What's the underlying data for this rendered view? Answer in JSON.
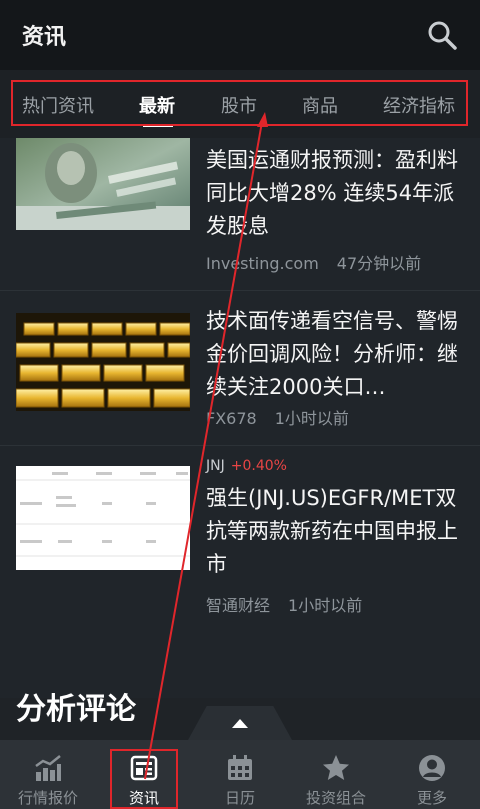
{
  "header": {
    "title": "资讯",
    "search_icon": "search-icon"
  },
  "tabs": [
    {
      "label": "热门资讯",
      "active": false
    },
    {
      "label": "最新",
      "active": true
    },
    {
      "label": "股市",
      "active": false
    },
    {
      "label": "商品",
      "active": false
    },
    {
      "label": "经济指标",
      "active": false
    }
  ],
  "news": [
    {
      "headline": "美国运通财报预测：盈利料同比大增28% 连续54年派发股息",
      "source": "Investing.com",
      "time": "47分钟以前"
    },
    {
      "headline": "技术面传递看空信号、警惕金价回调风险！分析师：继续关注2000关口…",
      "source": "FX678",
      "time": "1小时以前"
    },
    {
      "stock": "JNJ",
      "change": "+0.40%",
      "headline": "强生(JNJ.US)EGFR/MET双抗等两款新药在中国申报上市",
      "source": "智通财经",
      "time": "1小时以前"
    }
  ],
  "section": {
    "title": "分析评论"
  },
  "bottom_nav": [
    {
      "label": "行情报价",
      "icon": "chart-icon",
      "active": false
    },
    {
      "label": "资讯",
      "icon": "news-icon",
      "active": true
    },
    {
      "label": "日历",
      "icon": "calendar-icon",
      "active": false
    },
    {
      "label": "投资组合",
      "icon": "star-icon",
      "active": false
    },
    {
      "label": "更多",
      "icon": "user-icon",
      "active": false
    }
  ],
  "colors": {
    "accent_red": "#e0262b",
    "change_red": "#e84545",
    "header_bg": "#14171a",
    "list_bg": "#20252a",
    "nav_bg": "#2d3237"
  }
}
